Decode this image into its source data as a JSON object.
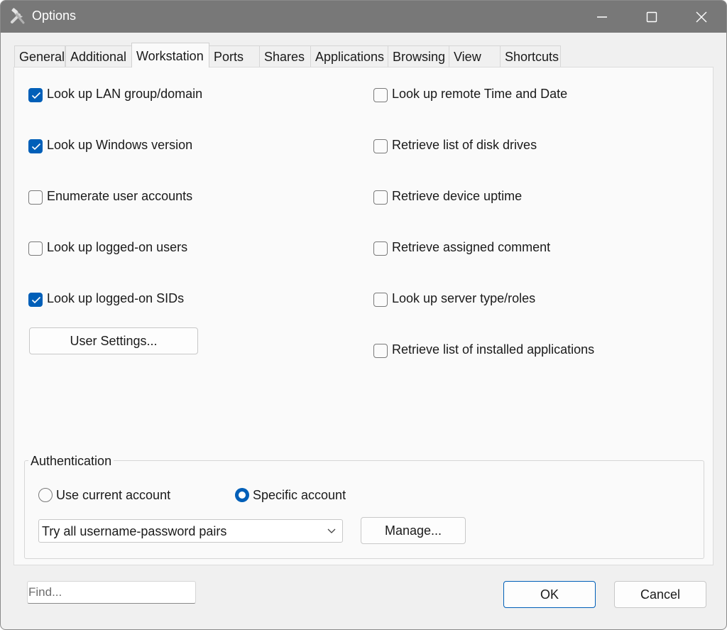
{
  "window": {
    "title": "Options"
  },
  "tabs": [
    "General",
    "Additional",
    "Workstation",
    "Ports",
    "Shares",
    "Applications",
    "Browsing",
    "View",
    "Shortcuts"
  ],
  "active_tab": "Workstation",
  "left_options": [
    {
      "label": "Look up LAN group/domain",
      "checked": true
    },
    {
      "label": "Look up Windows version",
      "checked": true
    },
    {
      "label": "Enumerate user accounts",
      "checked": false
    },
    {
      "label": "Look up logged-on users",
      "checked": false
    },
    {
      "label": "Look up logged-on SIDs",
      "checked": true
    }
  ],
  "right_options": [
    {
      "label": "Look up remote Time and Date",
      "checked": false
    },
    {
      "label": "Retrieve list of disk drives",
      "checked": false
    },
    {
      "label": "Retrieve device uptime",
      "checked": false
    },
    {
      "label": "Retrieve assigned comment",
      "checked": false
    },
    {
      "label": "Look up server type/roles",
      "checked": false
    },
    {
      "label": "Retrieve list of installed applications",
      "checked": false
    }
  ],
  "user_settings_label": "User Settings...",
  "authentication": {
    "title": "Authentication",
    "use_current_label": "Use current account",
    "specific_label": "Specific account",
    "selected": "specific",
    "credentials_value": "Try all username-password pairs",
    "manage_label": "Manage..."
  },
  "footer": {
    "find_placeholder": "Find...",
    "ok_label": "OK",
    "cancel_label": "Cancel"
  },
  "colors": {
    "accent": "#005fb8",
    "titlebar": "#787878"
  }
}
